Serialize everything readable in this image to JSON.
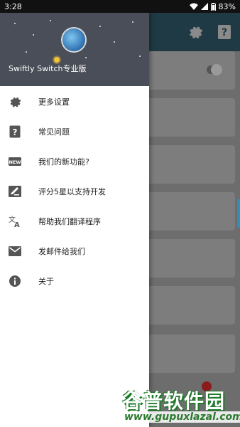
{
  "status_bar": {
    "time": "3:28",
    "battery": "83%"
  },
  "drawer": {
    "title": "Swiftly Switch专业版",
    "items": [
      {
        "icon": "gear-icon",
        "label": "更多设置"
      },
      {
        "icon": "help-icon",
        "label": "常见问题"
      },
      {
        "icon": "new-badge-icon",
        "label": "我们的新功能?"
      },
      {
        "icon": "rate-pen-icon",
        "label": "评分5星以支持开发"
      },
      {
        "icon": "translate-icon",
        "label": "帮助我们翻译程序"
      },
      {
        "icon": "mail-icon",
        "label": "发邮件给我们"
      },
      {
        "icon": "info-icon",
        "label": "关于"
      }
    ]
  },
  "watermark": {
    "brand": "谷普软件园",
    "url": "www.gupuxlazal.com"
  },
  "colors": {
    "toolbar": "#1f3a44",
    "accent": "#2f8fb8",
    "drawer_header": "#4a4e58"
  }
}
